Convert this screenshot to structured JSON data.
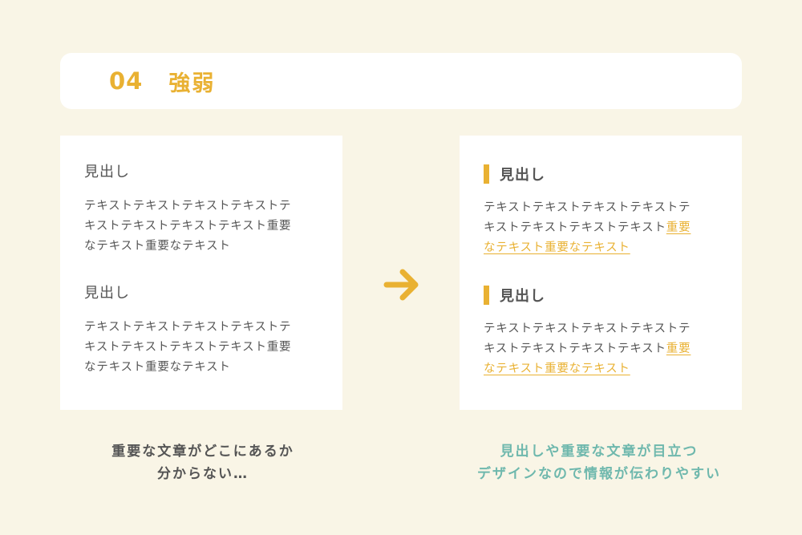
{
  "header": {
    "number": "04",
    "title": "強弱"
  },
  "left_panel": {
    "sections": [
      {
        "heading": "見出し",
        "lines": [
          "テキストテキストテキストテキストテ",
          "キストテキストテキストテキスト重要",
          "なテキスト重要なテキスト"
        ]
      },
      {
        "heading": "見出し",
        "lines": [
          "テキストテキストテキストテキストテ",
          "キストテキストテキストテキスト重要",
          "なテキスト重要なテキスト"
        ]
      }
    ]
  },
  "right_panel": {
    "sections": [
      {
        "heading": "見出し",
        "line1": "テキストテキストテキストテキストテ",
        "line2_plain": "キストテキストテキストテキスト",
        "line2_highlight": "重要",
        "line3_highlight": "なテキスト重要なテキスト"
      },
      {
        "heading": "見出し",
        "line1": "テキストテキストテキストテキストテ",
        "line2_plain": "キストテキストテキストテキスト",
        "line2_highlight": "重要",
        "line3_highlight": "なテキスト重要なテキスト"
      }
    ]
  },
  "arrow_icon": "arrow-right-icon",
  "captions": {
    "left": [
      "重要な文章がどこにあるか",
      "分からない…"
    ],
    "right": [
      "見出しや重要な文章が目立つ",
      "デザインなので情報が伝わりやすい"
    ]
  },
  "colors": {
    "background": "#f9f5e6",
    "accent": "#e9b132",
    "teal": "#6fb8ad",
    "text": "#555555"
  }
}
